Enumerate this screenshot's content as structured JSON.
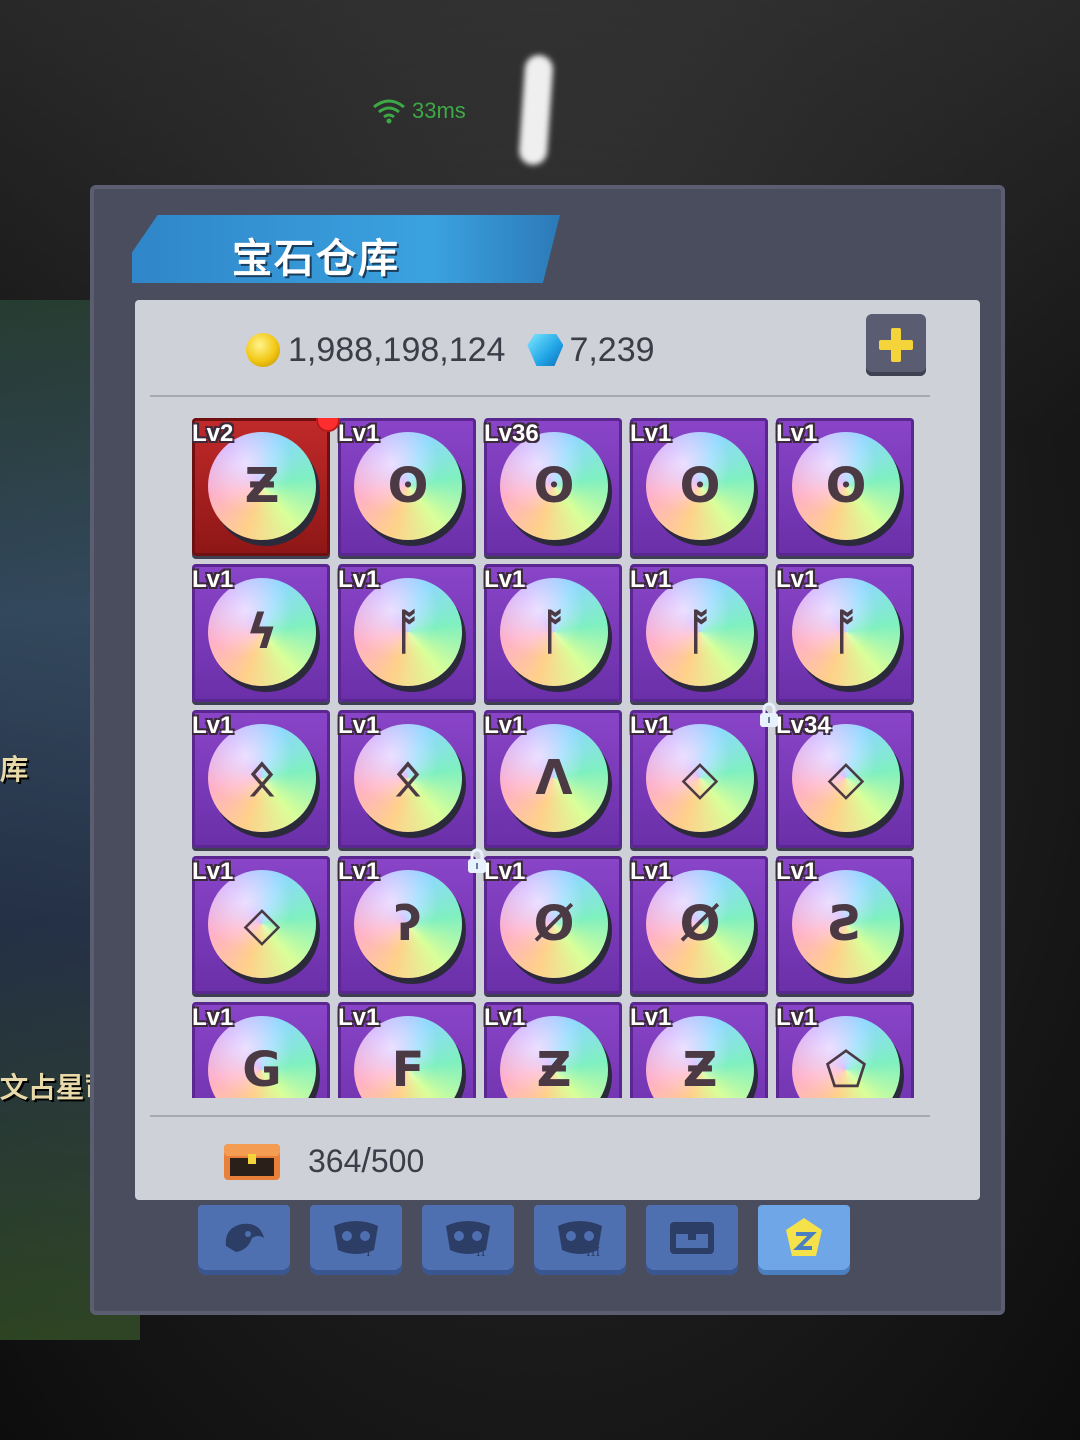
{
  "status": {
    "ping": "33ms"
  },
  "background": {
    "left_label_1": "库",
    "left_label_2": "文占星司"
  },
  "window": {
    "title": "宝石仓库"
  },
  "currency": {
    "gold": "1,988,198,124",
    "gems": "7,239"
  },
  "colors": {
    "slot": "#7a3bb8",
    "slot_selected": "#b52323",
    "accent": "#f5d33a",
    "banner": "#3a9ada"
  },
  "gems": [
    {
      "level": "Lv2",
      "glyph": "Ƶ",
      "selected": true,
      "new": true,
      "locked": false
    },
    {
      "level": "Lv1",
      "glyph": "ʘ",
      "selected": false,
      "new": false,
      "locked": false
    },
    {
      "level": "Lv36",
      "glyph": "ʘ",
      "selected": false,
      "new": false,
      "locked": false
    },
    {
      "level": "Lv1",
      "glyph": "ʘ",
      "selected": false,
      "new": false,
      "locked": false
    },
    {
      "level": "Lv1",
      "glyph": "ʘ",
      "selected": false,
      "new": false,
      "locked": false
    },
    {
      "level": "Lv1",
      "glyph": "ϟ",
      "selected": false,
      "new": false,
      "locked": false
    },
    {
      "level": "Lv1",
      "glyph": "ᚩ",
      "selected": false,
      "new": false,
      "locked": false
    },
    {
      "level": "Lv1",
      "glyph": "ᚩ",
      "selected": false,
      "new": false,
      "locked": false
    },
    {
      "level": "Lv1",
      "glyph": "ᚩ",
      "selected": false,
      "new": false,
      "locked": false
    },
    {
      "level": "Lv1",
      "glyph": "ᚩ",
      "selected": false,
      "new": false,
      "locked": false
    },
    {
      "level": "Lv1",
      "glyph": "ᛟ",
      "selected": false,
      "new": false,
      "locked": false
    },
    {
      "level": "Lv1",
      "glyph": "ᛟ",
      "selected": false,
      "new": false,
      "locked": false
    },
    {
      "level": "Lv1",
      "glyph": "Λ",
      "selected": false,
      "new": false,
      "locked": false
    },
    {
      "level": "Lv1",
      "glyph": "◇",
      "selected": false,
      "new": false,
      "locked": true
    },
    {
      "level": "Lv34",
      "glyph": "◇",
      "selected": false,
      "new": false,
      "locked": false
    },
    {
      "level": "Lv1",
      "glyph": "◇",
      "selected": false,
      "new": false,
      "locked": false
    },
    {
      "level": "Lv1",
      "glyph": "ʔ",
      "selected": false,
      "new": false,
      "locked": true
    },
    {
      "level": "Lv1",
      "glyph": "Ø",
      "selected": false,
      "new": false,
      "locked": false
    },
    {
      "level": "Lv1",
      "glyph": "Ø",
      "selected": false,
      "new": false,
      "locked": false
    },
    {
      "level": "Lv1",
      "glyph": "Ƨ",
      "selected": false,
      "new": false,
      "locked": false
    },
    {
      "level": "Lv1",
      "glyph": "G",
      "selected": false,
      "new": false,
      "locked": false
    },
    {
      "level": "Lv1",
      "glyph": "F",
      "selected": false,
      "new": false,
      "locked": false
    },
    {
      "level": "Lv1",
      "glyph": "Ƶ",
      "selected": false,
      "new": false,
      "locked": false
    },
    {
      "level": "Lv1",
      "glyph": "Ƶ",
      "selected": false,
      "new": false,
      "locked": false
    },
    {
      "level": "Lv1",
      "glyph": "⬠",
      "selected": false,
      "new": false,
      "locked": false
    }
  ],
  "capacity": {
    "used": "364",
    "separator": "/",
    "max": "500"
  },
  "tabs": [
    {
      "icon": "beast-head-icon",
      "active": false
    },
    {
      "icon": "mask-i-icon",
      "active": false
    },
    {
      "icon": "mask-ii-icon",
      "active": false
    },
    {
      "icon": "mask-iii-icon",
      "active": false
    },
    {
      "icon": "chest-tab-icon",
      "active": false
    },
    {
      "icon": "rune-gem-icon",
      "active": true
    }
  ]
}
